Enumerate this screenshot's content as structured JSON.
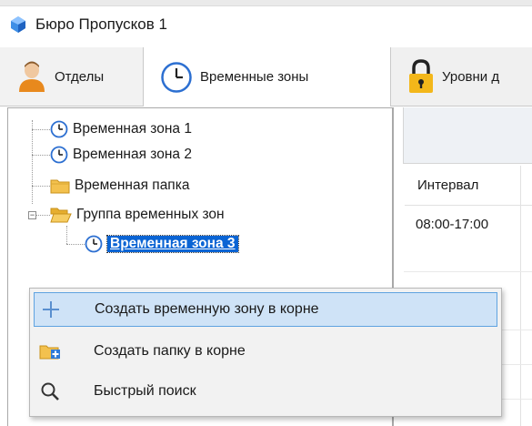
{
  "window": {
    "title": "Бюро Пропусков 1",
    "title_icon": "diamond-icon"
  },
  "tabs": [
    {
      "label": "Отделы",
      "icon": "person-icon",
      "selected": false
    },
    {
      "label": "Временные зоны",
      "icon": "clock-icon",
      "selected": true
    },
    {
      "label": "Уровни д",
      "icon": "lock-icon",
      "selected": false
    }
  ],
  "tree": {
    "items": [
      {
        "label": "Временная зона 1",
        "icon": "clock-icon"
      },
      {
        "label": "Временная зона 2",
        "icon": "clock-icon"
      },
      {
        "label": "Временная папка",
        "icon": "folder-icon"
      },
      {
        "label": "Группа временных зон",
        "icon": "folder-open-icon",
        "expanded": true
      },
      {
        "label": "Временная зона 3",
        "icon": "clock-icon",
        "selected": true
      }
    ]
  },
  "right_panel": {
    "column_header": "Интервал",
    "cells": [
      "08:00-17:00"
    ]
  },
  "context_menu": {
    "items": [
      {
        "label": "Создать временную зону в корне",
        "icon": "plus-icon",
        "highlighted": true
      },
      {
        "label": "Создать папку в корне",
        "icon": "folder-add-icon",
        "highlighted": false
      },
      {
        "label": "Быстрый поиск",
        "icon": "magnifier-icon",
        "highlighted": false
      }
    ]
  },
  "colors": {
    "selection": "#0a64d4",
    "menu_highlight": "#cfe3f7",
    "menu_highlight_border": "#5fa3e0",
    "folder": "#f3c14e",
    "clock": "#2c6fd1"
  }
}
